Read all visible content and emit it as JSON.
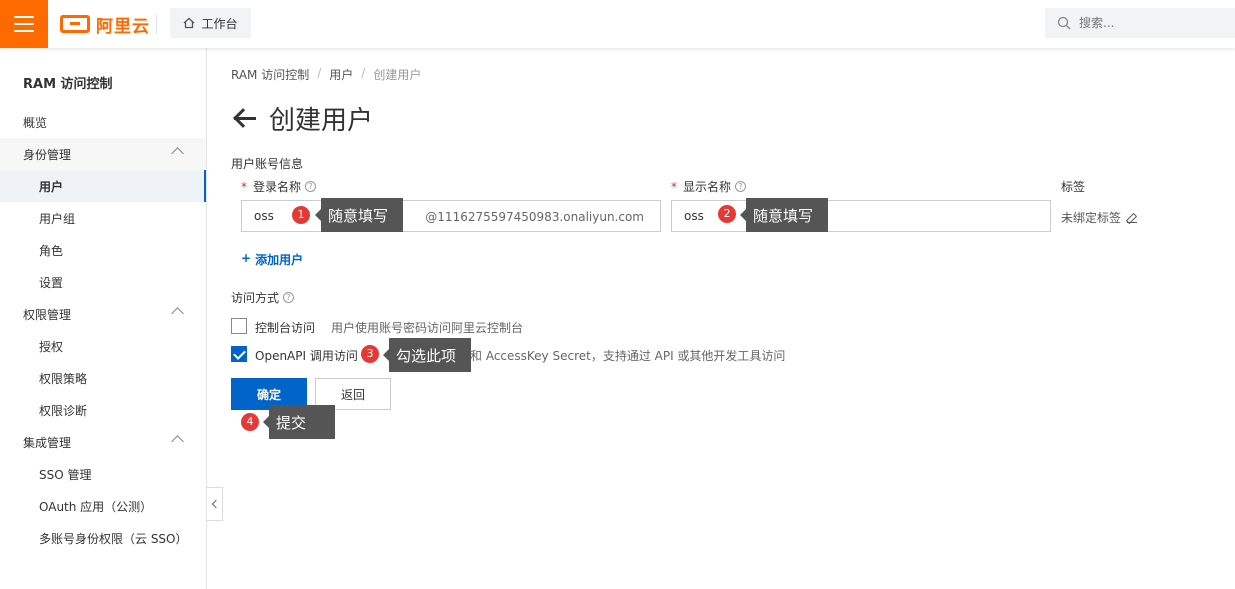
{
  "topbar": {
    "logo_text": "阿里云",
    "workbench_label": "工作台",
    "search_placeholder": "搜索..."
  },
  "sidebar": {
    "title": "RAM 访问控制",
    "items": [
      {
        "label": "概览"
      },
      {
        "label": "身份管理"
      },
      {
        "label": "用户"
      },
      {
        "label": "用户组"
      },
      {
        "label": "角色"
      },
      {
        "label": "设置"
      },
      {
        "label": "权限管理"
      },
      {
        "label": "授权"
      },
      {
        "label": "权限策略"
      },
      {
        "label": "权限诊断"
      },
      {
        "label": "集成管理"
      },
      {
        "label": "SSO 管理"
      },
      {
        "label": "OAuth 应用（公测）"
      },
      {
        "label": "多账号身份权限（云 SSO）"
      }
    ]
  },
  "breadcrumb": {
    "items": [
      "RAM 访问控制",
      "用户",
      "创建用户"
    ],
    "separator": "/"
  },
  "page": {
    "title": "创建用户"
  },
  "form": {
    "section_account": "用户账号信息",
    "login_name_label": "登录名称",
    "login_name_value": "oss",
    "login_name_suffix": "@1116275597450983.onaliyun.com",
    "display_name_label": "显示名称",
    "display_name_value": "oss",
    "tags_label": "标签",
    "tags_value": "未绑定标签",
    "add_user": "添加用户",
    "section_access": "访问方式",
    "console_access_label": "控制台访问",
    "console_access_desc": "用户使用账号密码访问阿里云控制台",
    "openapi_access_label": "OpenAPI 调用访问",
    "openapi_access_desc": "和 AccessKey Secret，支持通过 API 或其他开发工具访问",
    "confirm_label": "确定",
    "back_label": "返回"
  },
  "annotations": [
    {
      "num": "1",
      "text": "随意填写"
    },
    {
      "num": "2",
      "text": "随意填写"
    },
    {
      "num": "3",
      "text": "勾选此项"
    },
    {
      "num": "4",
      "text": "提交"
    }
  ],
  "colors": {
    "brand_orange": "#ff6a00",
    "primary_blue": "#0064c8",
    "badge_red": "#e53935",
    "callout_gray": "#555555"
  }
}
